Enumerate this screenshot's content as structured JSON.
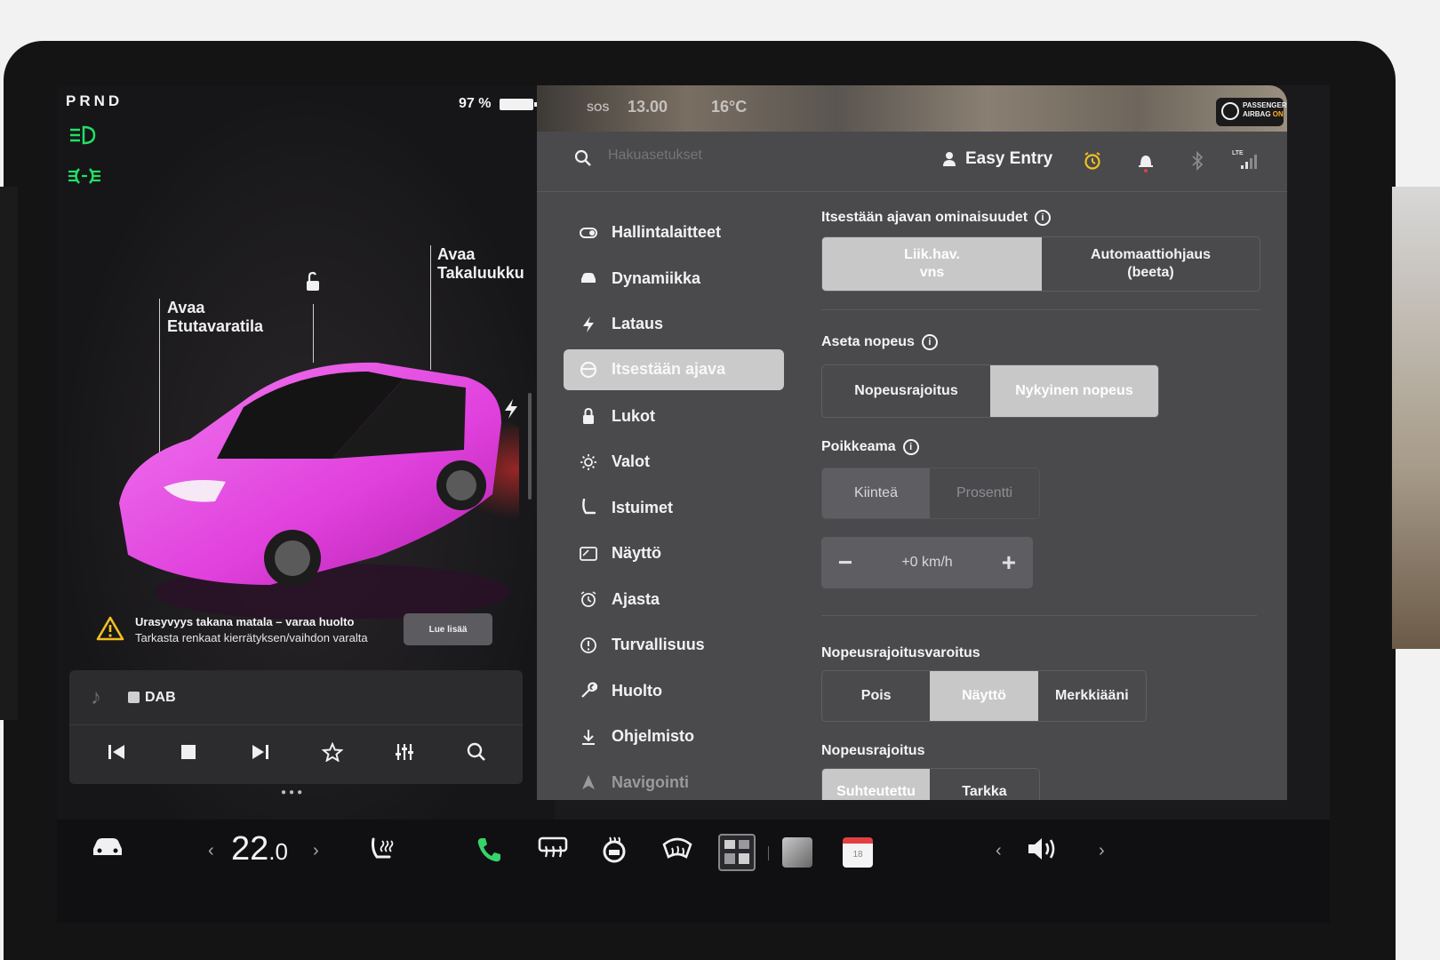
{
  "status": {
    "gear": "PRND",
    "battery_percent": "97 %"
  },
  "left": {
    "callout_frunk": [
      "Avaa",
      "Etutavaratila"
    ],
    "callout_trunk": [
      "Avaa",
      "Takaluukku"
    ],
    "car_color": "#e64fe0",
    "alert": {
      "line1": "Urasyvyys takana matala – varaa huolto",
      "line2": "Tarkasta renkaat kierrätyksen/vaihdon varalta",
      "button": "Lue lisää"
    },
    "media": {
      "source": "DAB",
      "controls": [
        "prev-icon",
        "stop-icon",
        "next-icon",
        "favorite-icon",
        "equalizer-icon",
        "search-icon"
      ]
    }
  },
  "map": {
    "text_sos": "SOS",
    "time": "13.00",
    "temp": "16°C",
    "airbag_line1": "PASSENGER",
    "airbag_line2": "AIRBAG",
    "airbag_state": "ON"
  },
  "topbar": {
    "search_placeholder": "Hakuasetukset",
    "profile_name": "Easy Entry",
    "lte": "LTE"
  },
  "nav": {
    "items": [
      {
        "label": "Hallintalaitteet",
        "icon": "toggle-icon"
      },
      {
        "label": "Dynamiikka",
        "icon": "car-icon"
      },
      {
        "label": "Lataus",
        "icon": "bolt-icon"
      },
      {
        "label": "Itsestään ajava",
        "icon": "steering-wheel-icon"
      },
      {
        "label": "Lukot",
        "icon": "lock-icon"
      },
      {
        "label": "Valot",
        "icon": "sun-icon"
      },
      {
        "label": "Istuimet",
        "icon": "seat-icon"
      },
      {
        "label": "Näyttö",
        "icon": "display-icon"
      },
      {
        "label": "Ajasta",
        "icon": "alarm-icon"
      },
      {
        "label": "Turvallisuus",
        "icon": "warning-icon"
      },
      {
        "label": "Huolto",
        "icon": "wrench-icon"
      },
      {
        "label": "Ohjelmisto",
        "icon": "download-icon"
      },
      {
        "label": "Navigointi",
        "icon": "navigation-icon"
      }
    ],
    "active_index": 3
  },
  "settings": {
    "autopilot_title": "Itsestään ajavan ominaisuudet",
    "autopilot_opt1_l1": "Liik.hav.",
    "autopilot_opt1_l2": "vns",
    "autopilot_opt2_l1": "Automaattiohjaus",
    "autopilot_opt2_l2": "(beeta)",
    "speed_title": "Aseta nopeus",
    "speed_opt1": "Nopeusrajoitus",
    "speed_opt2": "Nykyinen nopeus",
    "offset_title": "Poikkeama",
    "offset_opt1": "Kiinteä",
    "offset_opt2": "Prosentti",
    "offset_value": "+0 km/h",
    "warning_title": "Nopeusrajoitusvaroitus",
    "warning_opt1": "Pois",
    "warning_opt2": "Näyttö",
    "warning_opt3": "Merkkiääni",
    "limit_title": "Nopeusrajoitus",
    "limit_opt1": "Suhteutettu",
    "limit_opt2": "Tarkka"
  },
  "bottom": {
    "temp_main": "22",
    "temp_dec": ".0",
    "calendar_day": "18"
  },
  "colors": {
    "headlight_green": "#22e066",
    "alarm_yellow": "#f0c020",
    "phone_green": "#36d36a"
  }
}
